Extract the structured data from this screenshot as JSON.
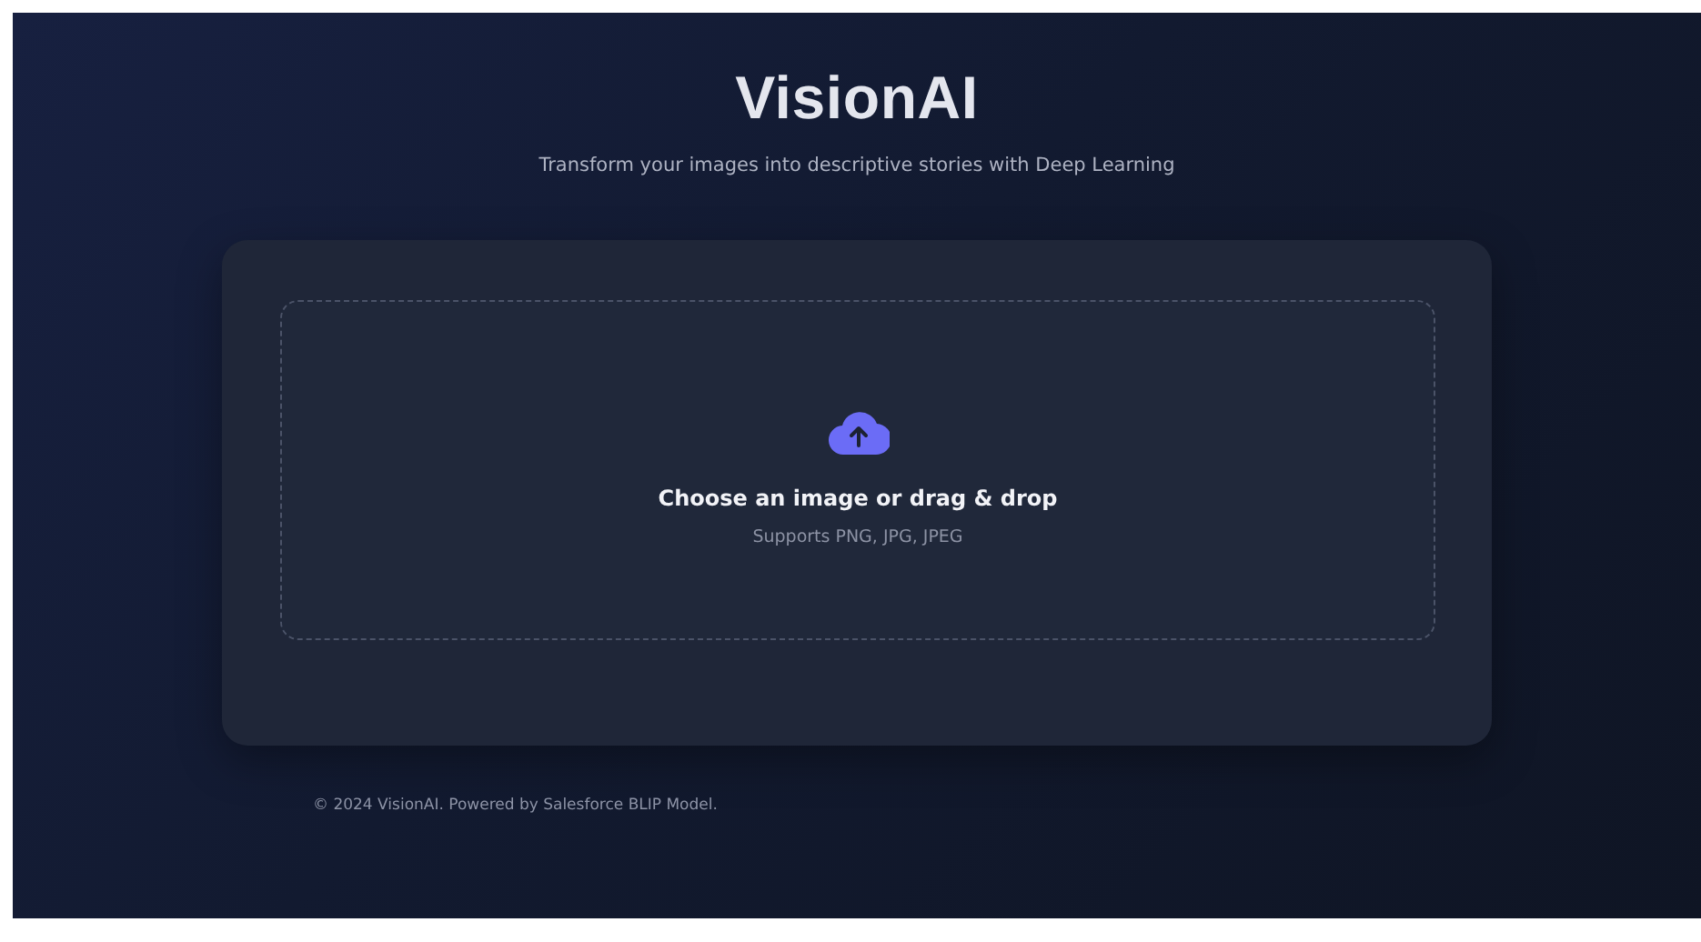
{
  "header": {
    "title": "VisionAI",
    "subtitle": "Transform your images into descriptive stories with Deep Learning"
  },
  "upload": {
    "prompt": "Choose an image or drag & drop",
    "formats": "Supports PNG, JPG, JPEG"
  },
  "footer": {
    "text": "© 2024 VisionAI. Powered by Salesforce BLIP Model."
  }
}
